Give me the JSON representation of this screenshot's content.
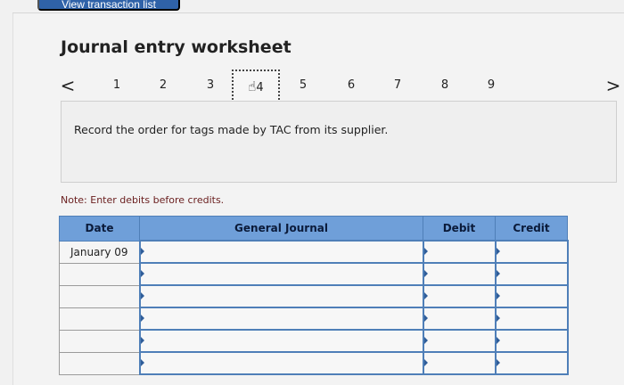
{
  "header": {
    "top_button_label": "View transaction list",
    "title": "Journal entry worksheet"
  },
  "navigation": {
    "prev_icon": "chevron-left-icon",
    "next_icon": "chevron-right-icon",
    "prev_glyph": "<",
    "next_glyph": ">",
    "steps": [
      {
        "label": "1"
      },
      {
        "label": "2"
      },
      {
        "label": "3"
      },
      {
        "label": "4"
      },
      {
        "label": "5"
      },
      {
        "label": "6"
      },
      {
        "label": "7"
      },
      {
        "label": "8"
      },
      {
        "label": "9"
      }
    ],
    "current_step": "4"
  },
  "instruction": {
    "text": "Record the order for tags made by TAC from its supplier."
  },
  "note": {
    "text": "Note: Enter debits before credits."
  },
  "table": {
    "headers": {
      "date": "Date",
      "journal": "General Journal",
      "debit": "Debit",
      "credit": "Credit"
    },
    "rows": [
      {
        "date": "January 09",
        "journal": "",
        "debit": "",
        "credit": ""
      },
      {
        "date": "",
        "journal": "",
        "debit": "",
        "credit": ""
      },
      {
        "date": "",
        "journal": "",
        "debit": "",
        "credit": ""
      },
      {
        "date": "",
        "journal": "",
        "debit": "",
        "credit": ""
      },
      {
        "date": "",
        "journal": "",
        "debit": "",
        "credit": ""
      },
      {
        "date": "",
        "journal": "",
        "debit": "",
        "credit": ""
      }
    ]
  },
  "colors": {
    "header_blue": "#6f9fd9",
    "border_blue": "#4f7fb8",
    "button_blue": "#2f62a8"
  }
}
